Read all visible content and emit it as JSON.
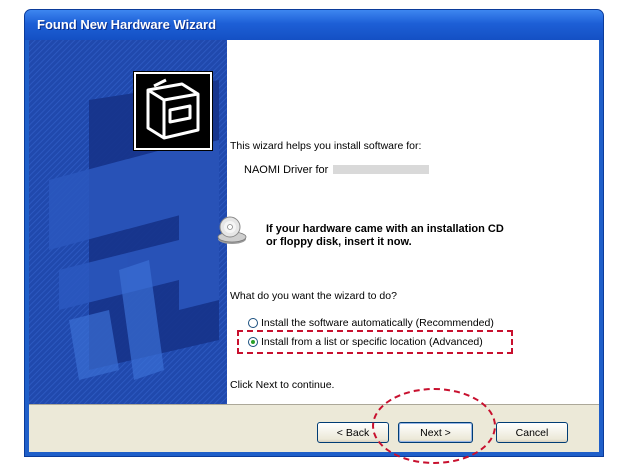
{
  "window": {
    "title": "Found New Hardware Wizard"
  },
  "content": {
    "intro": "This wizard helps you install software for:",
    "device_name": "NAOMI Driver for",
    "cd_prompt_line1": "If your hardware came with an installation CD",
    "cd_prompt_line2": "or floppy disk, insert it now.",
    "question": "What do you want the wizard to do?",
    "options": [
      {
        "label": "Install the software automatically (Recommended)",
        "selected": false
      },
      {
        "label": "Install from a list or specific location (Advanced)",
        "selected": true
      }
    ],
    "continue_hint": "Click Next to continue."
  },
  "buttons": {
    "back": "< Back",
    "next": "Next >",
    "cancel": "Cancel"
  },
  "colors": {
    "title_bar": "#1d5fd6",
    "banner": "#1e43a4",
    "highlight_annotation": "#c8102e"
  }
}
